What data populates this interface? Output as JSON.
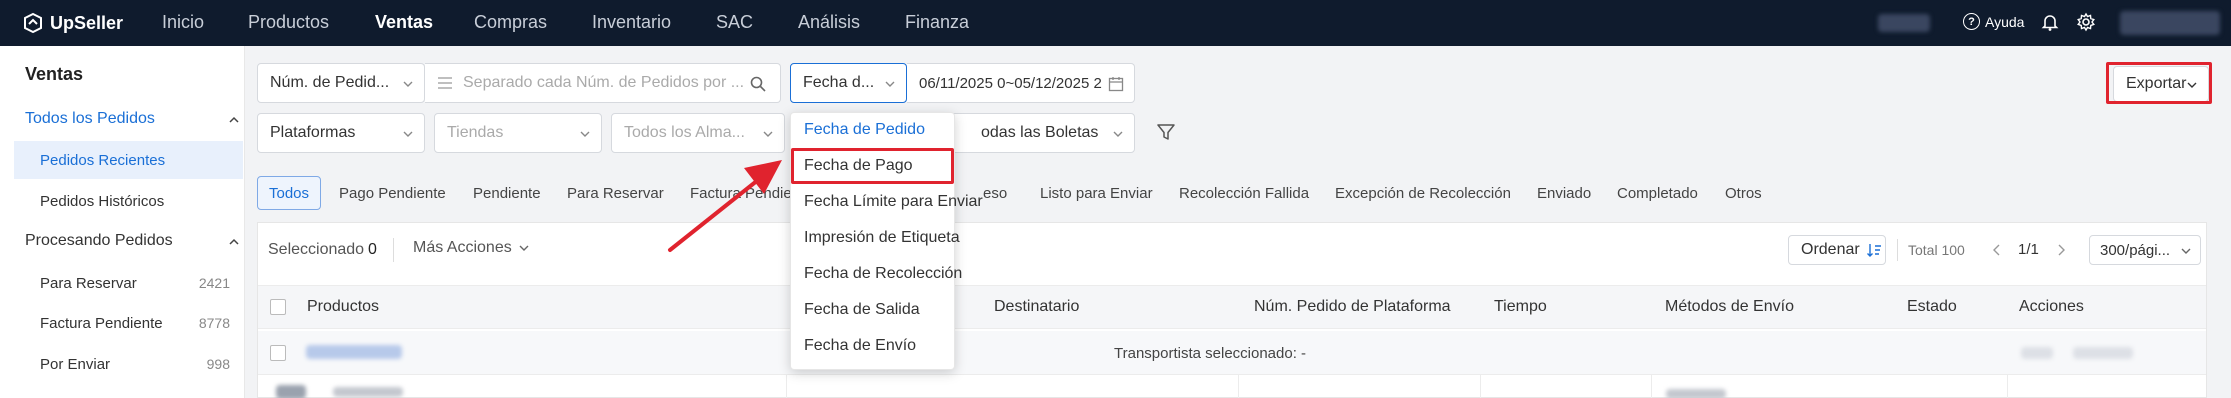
{
  "topbar": {
    "logo": "UpSeller",
    "nav": [
      "Inicio",
      "Productos",
      "Ventas",
      "Compras",
      "Inventario",
      "SAC",
      "Análisis",
      "Finanza"
    ],
    "active_nav": "Ventas",
    "help_label": "Ayuda"
  },
  "sidebar": {
    "title": "Ventas",
    "group_all": "Todos los Pedidos",
    "recent": "Pedidos Recientes",
    "historical": "Pedidos Históricos",
    "group_processing": "Procesando Pedidos",
    "processing_items": [
      {
        "label": "Para Reservar",
        "count": "2421"
      },
      {
        "label": "Factura Pendiente",
        "count": "8778"
      },
      {
        "label": "Por Enviar",
        "count": "998"
      }
    ]
  },
  "filters": {
    "order_field": "Núm. de Pedid...",
    "search_placeholder": "Separado cada Núm. de Pedidos por ...",
    "date_field": "Fecha d...",
    "date_range": "06/11/2025 0~05/12/2025 2",
    "export_label": "Exportar",
    "platforms": "Plataformas",
    "stores": "Tiendas",
    "warehouses": "Todos los Alma...",
    "slips": "odas las Boletas"
  },
  "tabs": [
    "Todos",
    "Pago Pendiente",
    "Pendiente",
    "Para Reservar",
    "Factura Pendie",
    "eso",
    "Listo para Enviar",
    "Recolección Fallida",
    "Excepción de Recolección",
    "Enviado",
    "Completado",
    "Otros"
  ],
  "toolbar": {
    "selected_label": "Seleccionado",
    "selected_count": "0",
    "more_actions": "Más Acciones",
    "sort_label": "Ordenar",
    "total": "Total 100",
    "page": "1/1",
    "per_page": "300/pági..."
  },
  "table": {
    "headers": [
      "Productos",
      "Destinatario",
      "Núm. Pedido de Plataforma",
      "Tiempo",
      "Métodos de Envío",
      "Estado",
      "Acciones"
    ],
    "carrier_note": "Transportista seleccionado: -"
  },
  "dropdown": {
    "items": [
      "Fecha de Pedido",
      "Fecha de Pago",
      "Fecha Límite para Enviar",
      "Impresión de Etiqueta",
      "Fecha de Recolección",
      "Fecha de Salida",
      "Fecha de Envío"
    ],
    "selected": "Fecha de Pedido",
    "highlighted": "Fecha de Pago"
  },
  "colors": {
    "accent": "#1a6fd6",
    "topbar": "#0f1b2d",
    "highlight": "#e0232e"
  }
}
